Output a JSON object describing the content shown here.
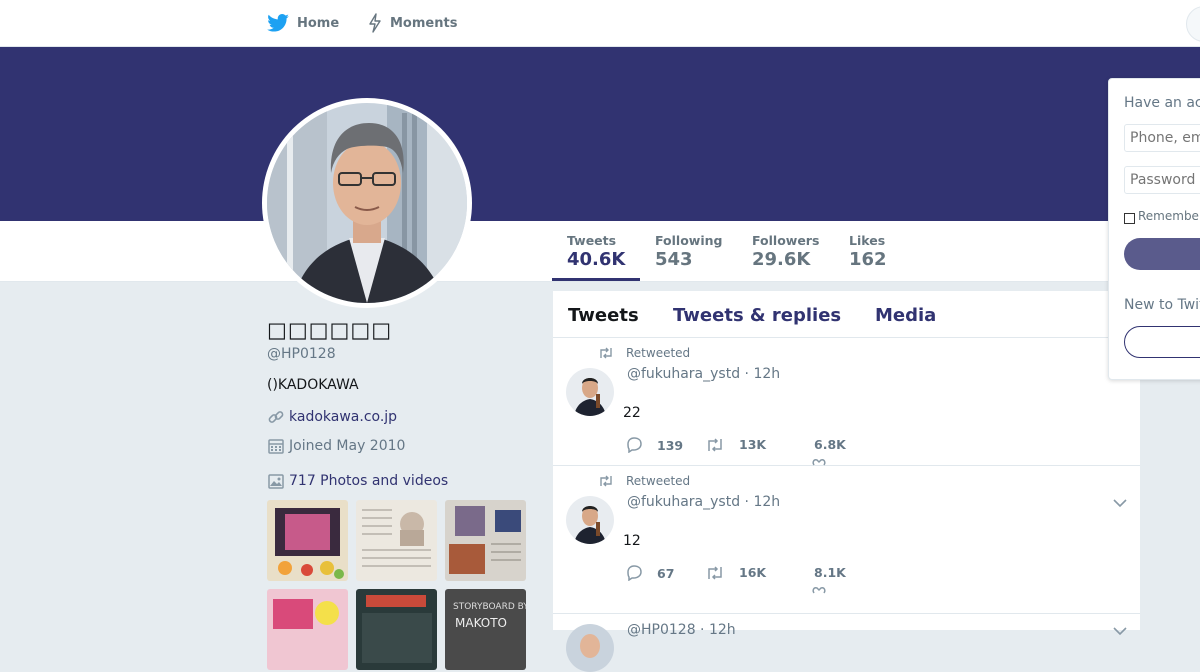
{
  "nav": {
    "home_label": "Home",
    "moments_label": "Moments"
  },
  "colors": {
    "brand": "#313371",
    "twitter_blue": "#1da1f2",
    "background": "#e6ecf0"
  },
  "stats": [
    {
      "label": "Tweets",
      "value": "40.6K",
      "active": true
    },
    {
      "label": "Following",
      "value": "543"
    },
    {
      "label": "Followers",
      "value": "29.6K"
    },
    {
      "label": "Likes",
      "value": "162"
    }
  ],
  "profile": {
    "name": "□□□□□□",
    "handle": "@HP0128",
    "bio": "()KADOKAWA",
    "url": "kadokawa.co.jp",
    "joined": "Joined May 2010",
    "photos_label": "717 Photos and videos"
  },
  "tabs": [
    "Tweets",
    "Tweets & replies",
    "Media"
  ],
  "tweets": [
    {
      "retweet_label": "Retweeted",
      "header": "@fukuhara_ystd · 12h",
      "text": "22",
      "replies": "139",
      "retweets": "13K",
      "likes": "6.8K"
    },
    {
      "retweet_label": "Retweeted",
      "header": "@fukuhara_ystd · 12h",
      "text": "12",
      "replies": "67",
      "retweets": "16K",
      "likes": "8.1K"
    },
    {
      "header": "@HP0128 · 12h"
    }
  ],
  "login": {
    "title": "Have an ac",
    "phone_placeholder": "Phone, em",
    "password_placeholder": "Password",
    "remember": "Remember",
    "new_label": "New to Twit"
  }
}
